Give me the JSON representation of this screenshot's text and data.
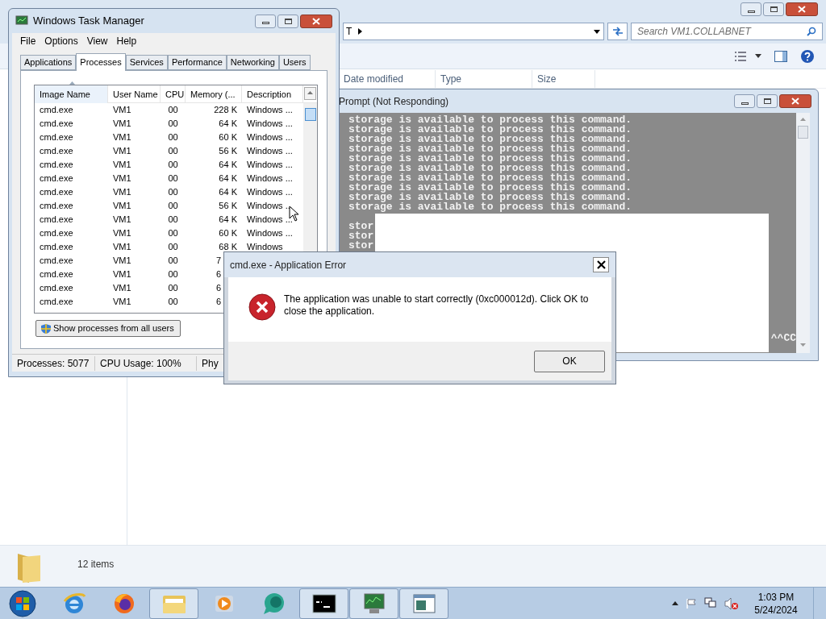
{
  "explorer": {
    "breadcrumb": "T",
    "search_placeholder": "Search VM1.COLLABNET",
    "columns": [
      "Date modified",
      "Type",
      "Size"
    ],
    "status": "12 items"
  },
  "cmd": {
    "title": "Prompt (Not Responding)",
    "lines": [
      "storage is available to process this command.",
      "storage is available to process this command.",
      "storage is available to process this command.",
      "storage is available to process this command.",
      "storage is available to process this command.",
      "storage is available to process this command.",
      "storage is available to process this command.",
      "storage is available to process this command.",
      "storage is available to process this command.",
      "storage is available to process this command."
    ],
    "partial_lines": [
      "stor",
      "stor",
      "stor"
    ],
    "tail": "^^CC"
  },
  "task_manager": {
    "title": "Windows Task Manager",
    "menu": [
      "File",
      "Options",
      "View",
      "Help"
    ],
    "tabs": [
      {
        "label": "Applications",
        "selected": false
      },
      {
        "label": "Processes",
        "selected": true
      },
      {
        "label": "Services",
        "selected": false
      },
      {
        "label": "Performance",
        "selected": false
      },
      {
        "label": "Networking",
        "selected": false
      },
      {
        "label": "Users",
        "selected": false
      }
    ],
    "columns": [
      "Image Name",
      "User Name",
      "CPU",
      "Memory (...",
      "Description"
    ],
    "rows": [
      {
        "image": "cmd.exe",
        "user": "VM1",
        "cpu": "00",
        "memory": "228 K",
        "description": "Windows ..."
      },
      {
        "image": "cmd.exe",
        "user": "VM1",
        "cpu": "00",
        "memory": "64 K",
        "description": "Windows ..."
      },
      {
        "image": "cmd.exe",
        "user": "VM1",
        "cpu": "00",
        "memory": "60 K",
        "description": "Windows ..."
      },
      {
        "image": "cmd.exe",
        "user": "VM1",
        "cpu": "00",
        "memory": "56 K",
        "description": "Windows ..."
      },
      {
        "image": "cmd.exe",
        "user": "VM1",
        "cpu": "00",
        "memory": "64 K",
        "description": "Windows ..."
      },
      {
        "image": "cmd.exe",
        "user": "VM1",
        "cpu": "00",
        "memory": "64 K",
        "description": "Windows ..."
      },
      {
        "image": "cmd.exe",
        "user": "VM1",
        "cpu": "00",
        "memory": "64 K",
        "description": "Windows ..."
      },
      {
        "image": "cmd.exe",
        "user": "VM1",
        "cpu": "00",
        "memory": "56 K",
        "description": "Windows ..."
      },
      {
        "image": "cmd.exe",
        "user": "VM1",
        "cpu": "00",
        "memory": "64 K",
        "description": "Windows ..."
      },
      {
        "image": "cmd.exe",
        "user": "VM1",
        "cpu": "00",
        "memory": "60 K",
        "description": "Windows ..."
      },
      {
        "image": "cmd.exe",
        "user": "VM1",
        "cpu": "00",
        "memory": "68 K",
        "description": "Windows"
      },
      {
        "image": "cmd.exe",
        "user": "VM1",
        "cpu": "00",
        "memory": "7"
      },
      {
        "image": "cmd.exe",
        "user": "VM1",
        "cpu": "00",
        "memory": "6"
      },
      {
        "image": "cmd.exe",
        "user": "VM1",
        "cpu": "00",
        "memory": "6"
      },
      {
        "image": "cmd.exe",
        "user": "VM1",
        "cpu": "00",
        "memory": "6"
      }
    ],
    "button": "Show processes from all users",
    "status": [
      "Processes: 5077",
      "CPU Usage: 100%",
      "Phy"
    ]
  },
  "dialog": {
    "title": "cmd.exe - Application Error",
    "message": "The application was unable to start correctly (0xc000012d). Click OK to close the application.",
    "button": "OK"
  },
  "taskbar": {
    "apps": [
      {
        "kind": "ie",
        "active": false
      },
      {
        "kind": "firefox",
        "active": false
      },
      {
        "kind": "folder",
        "active": true
      },
      {
        "kind": "media",
        "active": false
      },
      {
        "kind": "chat",
        "active": false
      },
      {
        "kind": "console",
        "active": true
      },
      {
        "kind": "monitor",
        "active": true
      },
      {
        "kind": "window",
        "active": true
      }
    ],
    "time": "1:03 PM",
    "date": "5/24/2024"
  }
}
